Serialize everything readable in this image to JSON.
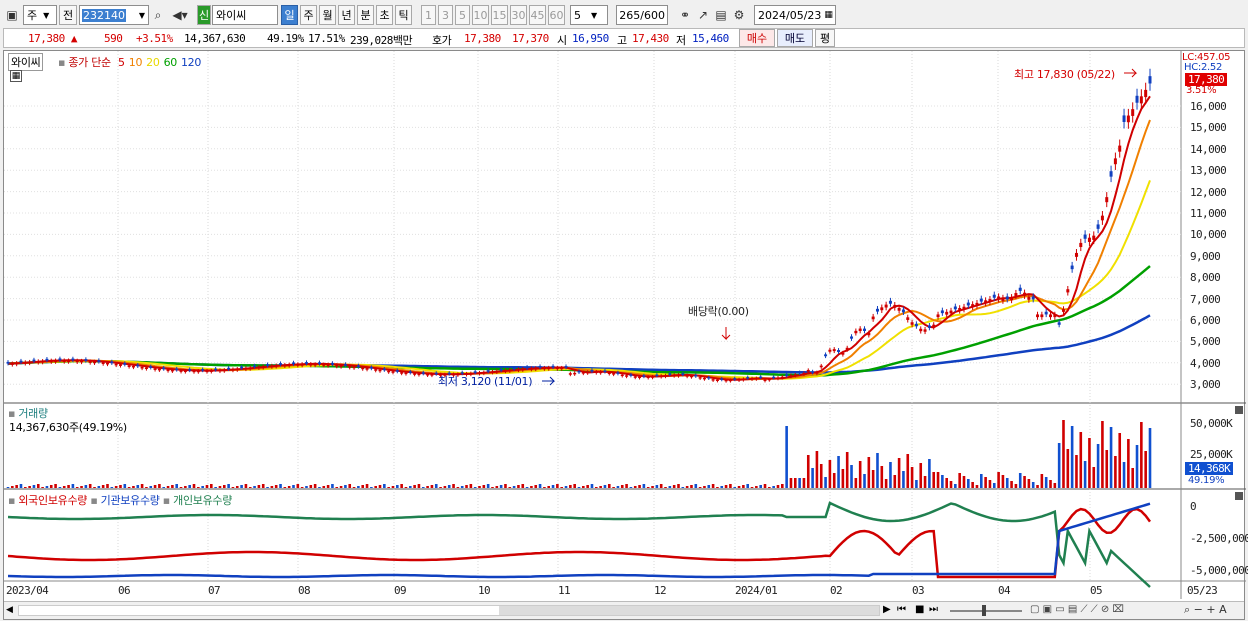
{
  "toolbar": {
    "market_type": "주",
    "all_label": "전",
    "stock_code": "232140",
    "stock_badge": "신",
    "stock_name": "와이씨",
    "period_buttons": [
      {
        "label": "일",
        "selected": true
      },
      {
        "label": "주",
        "selected": false
      },
      {
        "label": "월",
        "selected": false
      },
      {
        "label": "년",
        "selected": false
      },
      {
        "label": "분",
        "selected": false
      },
      {
        "label": "초",
        "selected": false
      },
      {
        "label": "틱",
        "selected": false
      }
    ],
    "interval_buttons": [
      "1",
      "3",
      "5",
      "10",
      "15",
      "30",
      "45",
      "60"
    ],
    "interval_value": "5",
    "data_count": "265",
    "data_total": "/600",
    "date": "2024/05/23"
  },
  "quote": {
    "price": "17,380",
    "change": "590",
    "change_pct": "+3.51%",
    "volume": "14,367,630",
    "volume_ratio": "49.19%",
    "turnover": "17.51%",
    "amount": "239,028백만",
    "bid_label": "호가",
    "ask_price": "17,380",
    "bid_price": "17,370",
    "open_label": "시",
    "open": "16,950",
    "high_label": "고",
    "high": "17,430",
    "low_label": "저",
    "low": "15,460",
    "buy_label": "매수",
    "sell_label": "매도",
    "avg_label": "평"
  },
  "price_panel": {
    "name_tag": "와이씨",
    "legend_prefix": "종가 단순",
    "ma_labels": [
      "5",
      "10",
      "20",
      "60",
      "120"
    ],
    "ma_colors": [
      "#d00000",
      "#f08000",
      "#e8d800",
      "#00a000",
      "#1040c0"
    ],
    "lc_label": "LC:457.05",
    "hc_label": "HC:2.52",
    "current_price": "17,380",
    "current_pct": "3.51%",
    "high_annotation": "최고 17,830 (05/22)",
    "low_annotation": "최저 3,120 (11/01)",
    "dividend_annotation": "배당락(0.00)",
    "y_ticks": [
      "16,000",
      "15,000",
      "14,000",
      "13,000",
      "12,000",
      "11,000",
      "10,000",
      "9,000",
      "8,000",
      "7,000",
      "6,000",
      "5,000",
      "4,000",
      "3,000"
    ]
  },
  "volume_panel": {
    "title": "거래량",
    "value_text": "14,367,630주(49.19%)",
    "y_ticks": [
      "50,000K",
      "25,000K"
    ],
    "current": "14,368K",
    "current_pct": "49.19%"
  },
  "holding_panel": {
    "labels": [
      "외국인보유수량",
      "기관보유수량",
      "개인보유수량"
    ],
    "colors": [
      "#d00000",
      "#1040c0",
      "#208050"
    ],
    "y_ticks": [
      "0",
      "-2,500,000",
      "-5,000,000"
    ]
  },
  "x_axis": [
    "2023/04",
    "06",
    "07",
    "08",
    "09",
    "10",
    "11",
    "12",
    "2024/01",
    "02",
    "03",
    "04",
    "05",
    "05/23"
  ]
}
